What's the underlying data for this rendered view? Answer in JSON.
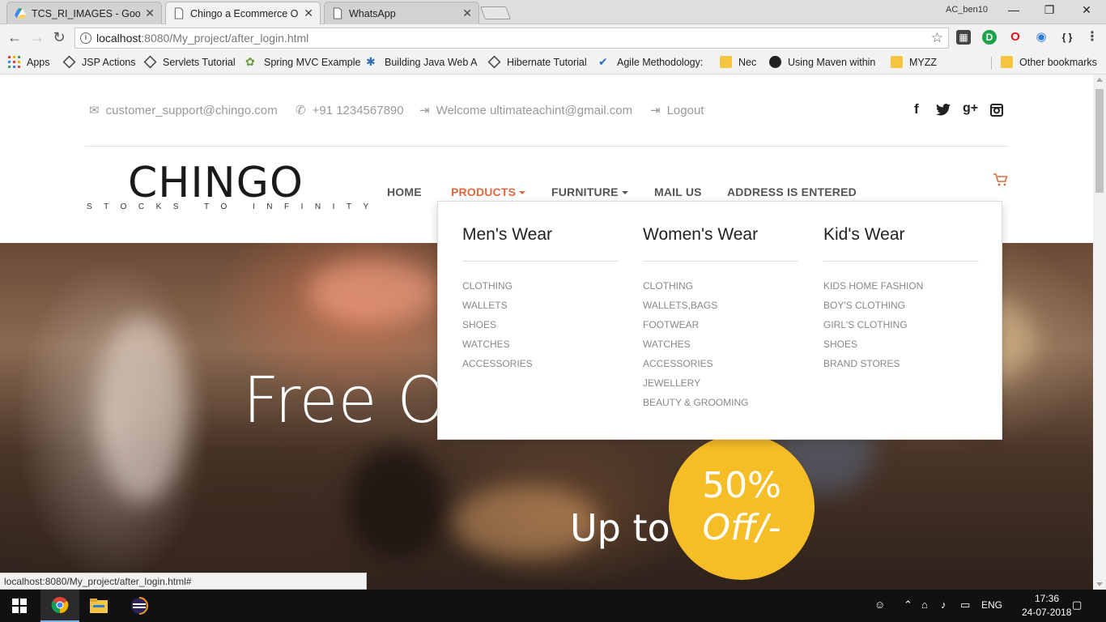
{
  "browser": {
    "tabs": [
      {
        "title": "TCS_RI_IMAGES - Google",
        "close": "✕"
      },
      {
        "title": "Chingo a Ecommerce On",
        "close": "✕"
      },
      {
        "title": "WhatsApp",
        "close": "✕"
      }
    ],
    "profile_name": "AC_ben10",
    "window_controls": {
      "minimize": "—",
      "restore": "❐",
      "close": "✕"
    },
    "url_host": "localhost",
    "url_path": ":8080/My_project/after_login.html",
    "extensions": [
      {
        "icon": "extension-grid-icon",
        "glyph": "▦"
      },
      {
        "icon": "extension-green-icon",
        "glyph": "D"
      },
      {
        "icon": "opera-icon",
        "glyph": "O"
      },
      {
        "icon": "extension-globe-icon",
        "glyph": "◉"
      },
      {
        "icon": "json-braces-icon",
        "glyph": "{ }"
      },
      {
        "icon": "menu-icon",
        "glyph": "⋮"
      }
    ]
  },
  "bookmarks": [
    {
      "label": "Apps",
      "icon": "apps-grid-icon"
    },
    {
      "label": "JSP Actions",
      "icon": "diamond-icon"
    },
    {
      "label": "Servlets Tutorial",
      "icon": "diamond-icon"
    },
    {
      "label": "Spring MVC Example",
      "icon": "spring-icon"
    },
    {
      "label": "Building Java Web A",
      "icon": "puzzle-icon"
    },
    {
      "label": "Hibernate Tutorial",
      "icon": "diamond-icon"
    },
    {
      "label": "Agile Methodology:",
      "icon": "check-icon"
    },
    {
      "label": "Nec",
      "icon": "folder-icon"
    },
    {
      "label": "Using Maven within",
      "icon": "maven-icon"
    },
    {
      "label": "MYZZ",
      "icon": "folder-icon"
    },
    {
      "label": "Other bookmarks",
      "icon": "folder-icon"
    }
  ],
  "site": {
    "email": "customer_support@chingo.com",
    "phone": "+91 1234567890",
    "welcome": "Welcome ultimateachint@gmail.com",
    "logout": "Logout",
    "social": [
      {
        "icon": "facebook-icon",
        "glyph": "f"
      },
      {
        "icon": "twitter-icon",
        "glyph": "🐦"
      },
      {
        "icon": "google-plus-icon",
        "glyph": "g+"
      },
      {
        "icon": "instagram-icon",
        "glyph": "◘"
      }
    ],
    "logo": "CHINGO",
    "tagline": "STOCKS TO INFINITY",
    "nav": {
      "home": "HOME",
      "products": "PRODUCTS",
      "furniture": "FURNITURE",
      "mail": "MAIL US",
      "address": "ADDRESS IS ENTERED"
    },
    "accent_color": "#e0683c",
    "mega_menu": [
      {
        "heading": "Men's Wear",
        "items": [
          "CLOTHING",
          "WALLETS",
          "SHOES",
          "WATCHES",
          "ACCESSORIES"
        ]
      },
      {
        "heading": "Women's Wear",
        "items": [
          "CLOTHING",
          "WALLETS,BAGS",
          "FOOTWEAR",
          "WATCHES",
          "ACCESSORIES",
          "JEWELLERY",
          "BEAUTY & GROOMING"
        ]
      },
      {
        "heading": "Kid's Wear",
        "items": [
          "KIDS HOME FASHION",
          "BOY'S CLOTHING",
          "GIRL'S CLOTHING",
          "SHOES",
          "BRAND STORES"
        ]
      }
    ],
    "hero": {
      "title": "Free O",
      "upto": "Up to",
      "percent": "50%",
      "off": "Off/-",
      "badge_color": "#f5bd26"
    }
  },
  "status_url": "localhost:8080/My_project/after_login.html#",
  "taskbar": {
    "language": "ENG",
    "time": "17:36",
    "date": "24-07-2018"
  }
}
